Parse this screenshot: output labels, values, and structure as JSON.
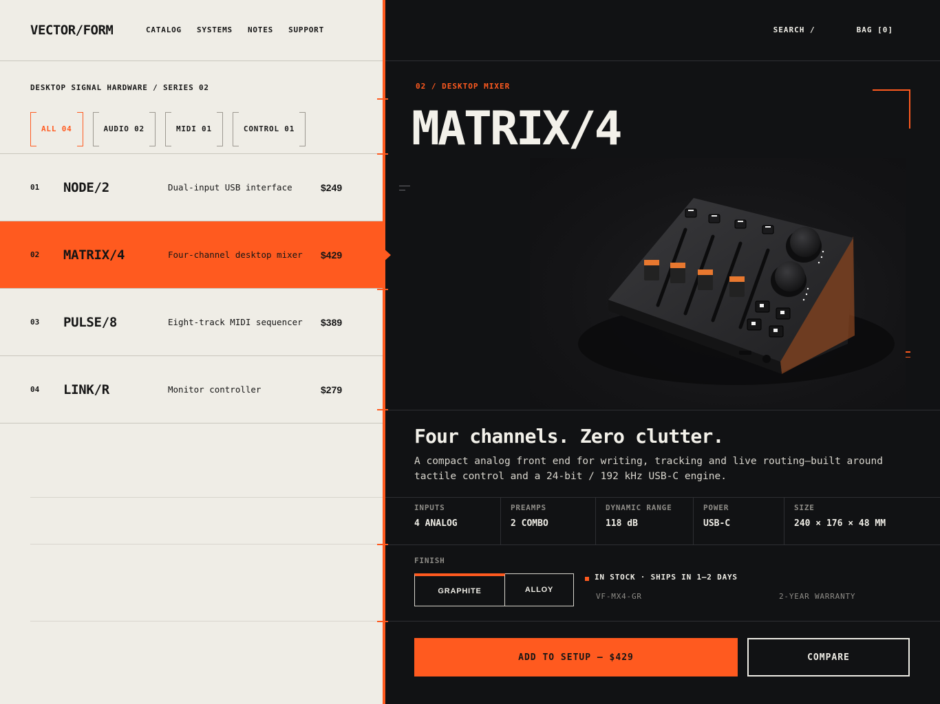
{
  "brand": "VECTOR/FORM",
  "nav": [
    "CATALOG",
    "SYSTEMS",
    "NOTES",
    "SUPPORT"
  ],
  "header_actions": {
    "search": "SEARCH /",
    "bag": "BAG [0]"
  },
  "breadcrumb": "DESKTOP SIGNAL HARDWARE / SERIES 02",
  "filters": [
    {
      "label": "ALL 04",
      "active": true
    },
    {
      "label": "AUDIO 02",
      "active": false
    },
    {
      "label": "MIDI 01",
      "active": false
    },
    {
      "label": "CONTROL 01",
      "active": false
    }
  ],
  "products": [
    {
      "num": "01",
      "name": "NODE/2",
      "desc": "Dual-input USB interface",
      "price": "$249",
      "selected": false
    },
    {
      "num": "02",
      "name": "MATRIX/4",
      "desc": "Four-channel desktop mixer",
      "price": "$429",
      "selected": true
    },
    {
      "num": "03",
      "name": "PULSE/8",
      "desc": "Eight-track MIDI sequencer",
      "price": "$389",
      "selected": false
    },
    {
      "num": "04",
      "name": "LINK/R",
      "desc": "Monitor controller",
      "price": "$279",
      "selected": false
    }
  ],
  "detail": {
    "eyebrow": "02 / DESKTOP MIXER",
    "title": "MATRIX/4",
    "image_alt": "product-photo",
    "headline": "Four channels. Zero clutter.",
    "lede": "A compact analog front end for writing, tracking and live routing—built around tactile control and a 24-bit / 192 kHz USB-C engine.",
    "specs": [
      {
        "key": "INPUTS",
        "value": "4 ANALOG"
      },
      {
        "key": "PREAMPS",
        "value": "2 COMBO"
      },
      {
        "key": "DYNAMIC RANGE",
        "value": "118 dB"
      },
      {
        "key": "POWER",
        "value": "USB-C"
      },
      {
        "key": "SIZE",
        "value": "240 × 176 × 48 MM"
      }
    ],
    "finish_label": "FINISH",
    "finishes": [
      {
        "label": "GRAPHITE",
        "active": true
      },
      {
        "label": "ALLOY",
        "active": false
      }
    ],
    "stock": "IN STOCK · SHIPS IN 1–2 DAYS",
    "sku": "VF-MX4-GR",
    "warranty": "2-YEAR WARRANTY",
    "cta": "ADD TO SETUP — $429",
    "compare": "COMPARE"
  },
  "colors": {
    "accent": "#ff5a1f",
    "light_bg": "#efede6",
    "dark_bg": "#111214"
  }
}
